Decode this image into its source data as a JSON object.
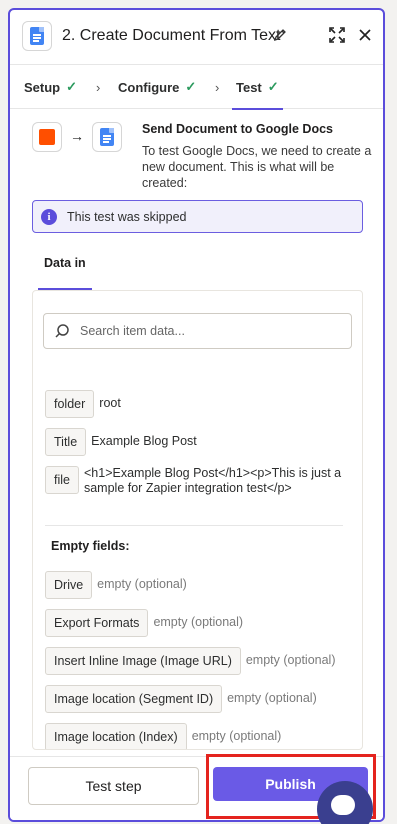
{
  "header": {
    "title": "2. Create Document From Text"
  },
  "steps": [
    {
      "label": "Setup"
    },
    {
      "label": "Configure"
    },
    {
      "label": "Test"
    }
  ],
  "summary": {
    "title": "Send Document to Google Docs",
    "description": "To test Google Docs, we need to create a new document. This is what will be created:"
  },
  "notice": {
    "text": "This test was skipped"
  },
  "tabs": {
    "data_in": "Data in"
  },
  "search": {
    "placeholder": "Search item data..."
  },
  "fields": [
    {
      "key": "folder",
      "value": "root"
    },
    {
      "key": "Title",
      "value": "Example Blog Post"
    },
    {
      "key": "file",
      "value": "<h1>Example Blog Post</h1><p>This is just a sample for Zapier integration test</p>"
    }
  ],
  "empty_section": {
    "title": "Empty fields:",
    "items": [
      {
        "key": "Drive",
        "value": "empty (optional)"
      },
      {
        "key": "Export Formats",
        "value": "empty (optional)"
      },
      {
        "key": "Insert Inline Image (Image URL)",
        "value": "empty (optional)"
      },
      {
        "key": "Image location (Segment ID)",
        "value": "empty (optional)"
      },
      {
        "key": "Image location (Index)",
        "value": "empty (optional)"
      }
    ]
  },
  "footer": {
    "test_label": "Test step",
    "publish_label": "Publish"
  },
  "colors": {
    "accent": "#5b4ddb",
    "publish": "#6a5ae6",
    "highlight": "#e4231e",
    "success": "#2b9a5e"
  }
}
